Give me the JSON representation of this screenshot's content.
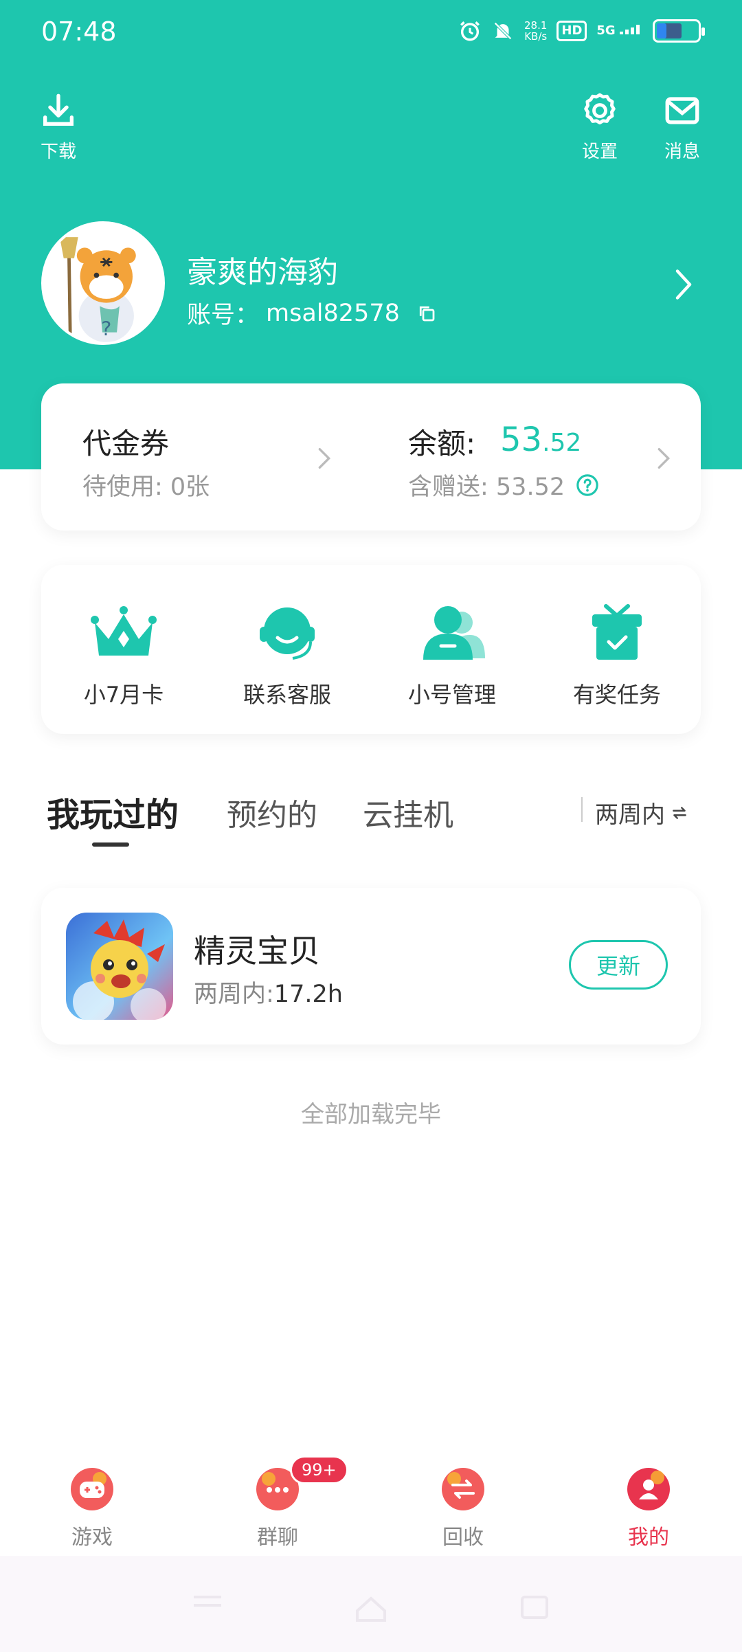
{
  "status_bar": {
    "time": "07:48",
    "network_speed_value": "28.1",
    "network_speed_unit": "KB/s",
    "hd_label": "HD",
    "signal_label": "5G",
    "battery_percent": 65
  },
  "top_actions": {
    "download_label": "下载",
    "settings_label": "设置",
    "messages_label": "消息"
  },
  "profile": {
    "name": "豪爽的海豹",
    "account_prefix": "账号：",
    "account_id": "msal82578"
  },
  "wallet": {
    "coupon_title": "代金券",
    "coupon_status": "待使用: 0张",
    "balance_label": "余额:",
    "balance_int": "53",
    "balance_dec": ".52",
    "balance_sub": "含赠送: 53.52"
  },
  "shortcuts": [
    {
      "label": "小7月卡",
      "icon": "crown-icon"
    },
    {
      "label": "联系客服",
      "icon": "headset-icon"
    },
    {
      "label": "小号管理",
      "icon": "users-icon"
    },
    {
      "label": "有奖任务",
      "icon": "gift-icon"
    }
  ],
  "tabs": [
    {
      "label": "我玩过的",
      "active": true
    },
    {
      "label": "预约的",
      "active": false
    },
    {
      "label": "云挂机",
      "active": false
    }
  ],
  "filter": {
    "label": "两周内",
    "icon": "swap-icon"
  },
  "games": [
    {
      "name": "精灵宝贝",
      "meta_label": "两周内:",
      "meta_value": "17.2h",
      "action": "更新"
    }
  ],
  "load_complete": "全部加载完毕",
  "bottom_nav": {
    "items": [
      {
        "label": "游戏",
        "icon": "gamepad-icon",
        "active": false
      },
      {
        "label": "群聊",
        "icon": "chat-icon",
        "active": false,
        "badge": "99+"
      },
      {
        "label": "回收",
        "icon": "exchange-icon",
        "active": false
      },
      {
        "label": "我的",
        "icon": "person-icon",
        "active": true
      }
    ]
  },
  "colors": {
    "accent": "#1EC6AE",
    "active_nav": "#E8344E"
  }
}
